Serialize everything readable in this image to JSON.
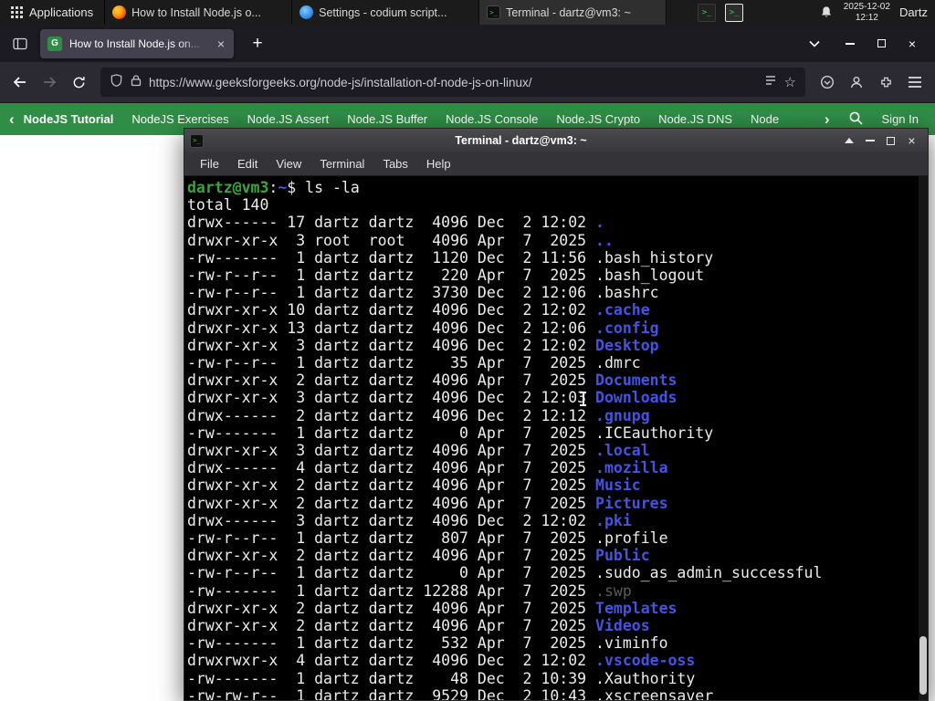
{
  "colors": {
    "site_green": "#2f8d46",
    "terminal_prompt_green": "#3aa73a",
    "terminal_dir_blue": "#4553e2",
    "panel_bg": "#1b1b1b"
  },
  "panel": {
    "applications_label": "Applications",
    "windows": [
      {
        "title": "How to Install Node.js o..."
      },
      {
        "title": "Settings - codium script..."
      },
      {
        "title": "Terminal - dartz@vm3: ~"
      }
    ],
    "clock_date": "2025-12-02",
    "clock_time": "12:12",
    "user": "Dartz"
  },
  "browser": {
    "tab": {
      "title": "How to Install Node.js on...",
      "close": "×"
    },
    "new_tab": "+",
    "url": "https://www.geeksforgeeks.org/node-js/installation-of-node-js-on-linux/",
    "star": "☆",
    "nav": {
      "chevron_left": "‹",
      "chevron_right": "›",
      "items": [
        "NodeJS Tutorial",
        "NodeJS Exercises",
        "Node.JS Assert",
        "Node.JS Buffer",
        "Node.JS Console",
        "Node.JS Crypto",
        "Node.JS DNS",
        "Node"
      ],
      "sign_in": "Sign In"
    },
    "window_controls": {
      "close": "×"
    }
  },
  "terminal": {
    "title": "Terminal - dartz@vm3: ~",
    "menus": [
      "File",
      "Edit",
      "View",
      "Terminal",
      "Tabs",
      "Help"
    ],
    "prompt": {
      "user": "dartz@vm3",
      "colon": ":",
      "path": "~",
      "dollar": "$ "
    },
    "command": "ls -la",
    "total_line": "total 140",
    "listing": [
      [
        "drwx------",
        17,
        "dartz",
        "dartz",
        4096,
        "Dec",
        2,
        "12:02",
        ".",
        "d"
      ],
      [
        "drwxr-xr-x",
        3,
        "root",
        "root",
        4096,
        "Apr",
        7,
        "2025",
        "..",
        "d"
      ],
      [
        "-rw-------",
        1,
        "dartz",
        "dartz",
        1120,
        "Dec",
        2,
        "11:56",
        ".bash_history",
        "f"
      ],
      [
        "-rw-r--r--",
        1,
        "dartz",
        "dartz",
        220,
        "Apr",
        7,
        "2025",
        ".bash_logout",
        "f"
      ],
      [
        "-rw-r--r--",
        1,
        "dartz",
        "dartz",
        3730,
        "Dec",
        2,
        "12:06",
        ".bashrc",
        "f"
      ],
      [
        "drwxr-xr-x",
        10,
        "dartz",
        "dartz",
        4096,
        "Dec",
        2,
        "12:02",
        ".cache",
        "d"
      ],
      [
        "drwxr-xr-x",
        13,
        "dartz",
        "dartz",
        4096,
        "Dec",
        2,
        "12:06",
        ".config",
        "d"
      ],
      [
        "drwxr-xr-x",
        3,
        "dartz",
        "dartz",
        4096,
        "Dec",
        2,
        "12:02",
        "Desktop",
        "d"
      ],
      [
        "-rw-r--r--",
        1,
        "dartz",
        "dartz",
        35,
        "Apr",
        7,
        "2025",
        ".dmrc",
        "f"
      ],
      [
        "drwxr-xr-x",
        2,
        "dartz",
        "dartz",
        4096,
        "Apr",
        7,
        "2025",
        "Documents",
        "d"
      ],
      [
        "drwxr-xr-x",
        3,
        "dartz",
        "dartz",
        4096,
        "Dec",
        2,
        "12:03",
        "Downloads",
        "d"
      ],
      [
        "drwx------",
        2,
        "dartz",
        "dartz",
        4096,
        "Dec",
        2,
        "12:12",
        ".gnupg",
        "d"
      ],
      [
        "-rw-------",
        1,
        "dartz",
        "dartz",
        0,
        "Apr",
        7,
        "2025",
        ".ICEauthority",
        "f"
      ],
      [
        "drwxr-xr-x",
        3,
        "dartz",
        "dartz",
        4096,
        "Apr",
        7,
        "2025",
        ".local",
        "d"
      ],
      [
        "drwx------",
        4,
        "dartz",
        "dartz",
        4096,
        "Apr",
        7,
        "2025",
        ".mozilla",
        "d"
      ],
      [
        "drwxr-xr-x",
        2,
        "dartz",
        "dartz",
        4096,
        "Apr",
        7,
        "2025",
        "Music",
        "d"
      ],
      [
        "drwxr-xr-x",
        2,
        "dartz",
        "dartz",
        4096,
        "Apr",
        7,
        "2025",
        "Pictures",
        "d"
      ],
      [
        "drwx------",
        3,
        "dartz",
        "dartz",
        4096,
        "Dec",
        2,
        "12:02",
        ".pki",
        "d"
      ],
      [
        "-rw-r--r--",
        1,
        "dartz",
        "dartz",
        807,
        "Apr",
        7,
        "2025",
        ".profile",
        "f"
      ],
      [
        "drwxr-xr-x",
        2,
        "dartz",
        "dartz",
        4096,
        "Apr",
        7,
        "2025",
        "Public",
        "d"
      ],
      [
        "-rw-r--r--",
        1,
        "dartz",
        "dartz",
        0,
        "Apr",
        7,
        "2025",
        ".sudo_as_admin_successful",
        "f"
      ],
      [
        "-rw-------",
        1,
        "dartz",
        "dartz",
        12288,
        "Apr",
        7,
        "2025",
        ".swp",
        "x"
      ],
      [
        "drwxr-xr-x",
        2,
        "dartz",
        "dartz",
        4096,
        "Apr",
        7,
        "2025",
        "Templates",
        "d"
      ],
      [
        "drwxr-xr-x",
        2,
        "dartz",
        "dartz",
        4096,
        "Apr",
        7,
        "2025",
        "Videos",
        "d"
      ],
      [
        "-rw-------",
        1,
        "dartz",
        "dartz",
        532,
        "Apr",
        7,
        "2025",
        ".viminfo",
        "f"
      ],
      [
        "drwxrwxr-x",
        4,
        "dartz",
        "dartz",
        4096,
        "Dec",
        2,
        "12:02",
        ".vscode-oss",
        "d"
      ],
      [
        "-rw-------",
        1,
        "dartz",
        "dartz",
        48,
        "Dec",
        2,
        "10:39",
        ".Xauthority",
        "f"
      ],
      [
        "-rw-rw-r--",
        1,
        "dartz",
        "dartz",
        9529,
        "Dec",
        2,
        "10:43",
        ".xscreensaver",
        "f"
      ]
    ],
    "controls": {
      "close": "×"
    }
  }
}
